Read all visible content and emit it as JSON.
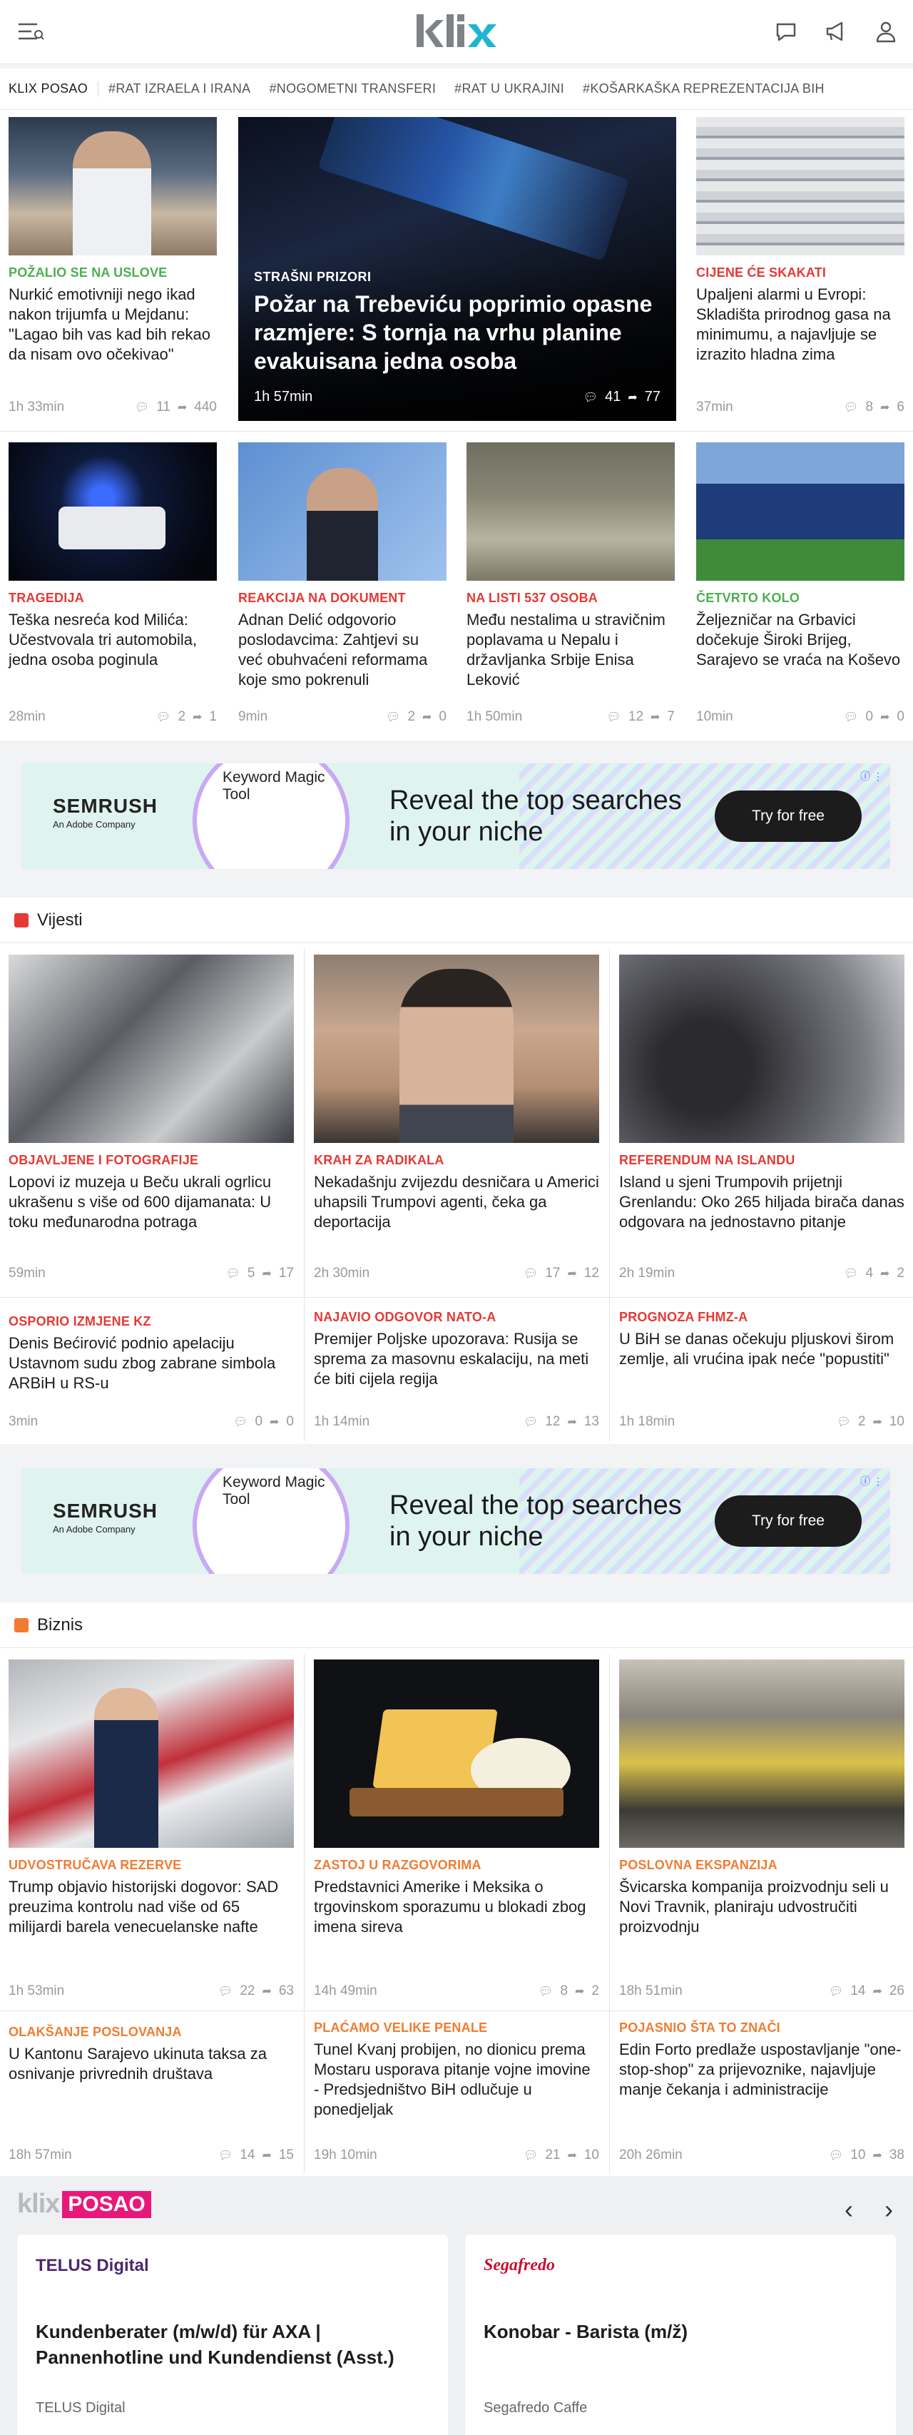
{
  "header": {
    "logo": "klix",
    "icons": [
      "menu-icon",
      "chat-icon",
      "megaphone-icon",
      "user-icon"
    ]
  },
  "tags": [
    "KLIX POSAO",
    "#RAT IZRAELA I IRANA",
    "#NOGOMETNI TRANSFERI",
    "#RAT U UKRAJINI",
    "#KOŠARKAŠKA REPREZENTACIJA BIH"
  ],
  "top": {
    "hero": {
      "category": "STRAŠNI PRIZORI",
      "title": "Požar na Trebeviću poprimio opasne razmjere: S tornja na vrhu planine evakuisana jedna osoba",
      "time": "1h 57min",
      "comments": "41",
      "shares": "77"
    },
    "cards": [
      {
        "category": "POŽALIO SE NA USLOVE",
        "color": "#4caf50",
        "title": "Nurkić emotivniji nego ikad nakon trijumfa u Mejdanu: \"Lagao bih vas kad bih rekao da nisam ovo očekivao\"",
        "time": "1h 33min",
        "comments": "11",
        "shares": "440"
      },
      {
        "category": "CIJENE ĆE SKAKATI",
        "color": "#e53935",
        "title": "Upaljeni alarmi u Evropi: Skladišta prirodnog gasa na minimumu, a najavljuje se izrazito hladna zima",
        "time": "37min",
        "comments": "8",
        "shares": "6"
      },
      {
        "category": "TRAGEDIJA",
        "color": "#e53935",
        "title": "Teška nesreća kod Milića: Učestvovala tri automobila, jedna osoba poginula",
        "time": "28min",
        "comments": "2",
        "shares": "1"
      },
      {
        "category": "REAKCIJA NA DOKUMENT",
        "color": "#e53935",
        "title": "Adnan Delić odgovorio poslodavcima: Zahtjevi su već obuhvaćeni reformama koje smo pokrenuli",
        "time": "9min",
        "comments": "2",
        "shares": "0"
      },
      {
        "category": "NA LISTI 537 OSOBA",
        "color": "#e53935",
        "title": "Među nestalima u stravičnim poplavama u Nepalu i državljanka Srbije Enisa Leković",
        "time": "1h 50min",
        "comments": "12",
        "shares": "7"
      },
      {
        "category": "ČETVRTO KOLO",
        "color": "#4caf50",
        "title": "Željezničar na Grbavici dočekuje Široki Brijeg, Sarajevo se vraća na Koševo",
        "time": "10min",
        "comments": "0",
        "shares": "0"
      }
    ]
  },
  "ad": {
    "brand": "SEMRUSH",
    "brand_sub": "An Adobe Company",
    "tool": "Keyword Magic Tool",
    "headline": "Reveal the top searches in your niche",
    "cta": "Try for free"
  },
  "vijesti": {
    "label": "Vijesti",
    "color": "#e53935",
    "cards": [
      {
        "category": "OBJAVLJENE I FOTOGRAFIJE",
        "title": "Lopovi iz muzeja u Beču ukrali ogrlicu ukrašenu s više od 600 dijamanata: U toku međunarodna potraga",
        "time": "59min",
        "comments": "5",
        "shares": "17"
      },
      {
        "category": "KRAH ZA RADIKALA",
        "title": "Nekadašnju zvijezdu desničara u Americi uhapsili Trumpovi agenti, čeka ga deportacija",
        "time": "2h 30min",
        "comments": "17",
        "shares": "12"
      },
      {
        "category": "REFERENDUM NA ISLANDU",
        "title": "Island u sjeni Trumpovih prijetnji Grenlandu: Oko 265 hiljada birača danas odgovara na jednostavno pitanje",
        "time": "2h 19min",
        "comments": "4",
        "shares": "2"
      },
      {
        "category": "OSPORIO IZMJENE KZ",
        "title": "Denis Bećirović podnio apelaciju Ustavnom sudu zbog zabrane simbola ARBiH u RS-u",
        "time": "3min",
        "comments": "0",
        "shares": "0"
      },
      {
        "category": "NAJAVIO ODGOVOR NATO-A",
        "title": "Premijer Poljske upozorava: Rusija se sprema za masovnu eskalaciju, na meti će biti cijela regija",
        "time": "1h 14min",
        "comments": "12",
        "shares": "13"
      },
      {
        "category": "PROGNOZA FHMZ-A",
        "title": "U BiH se danas očekuju pljuskovi širom zemlje, ali vrućina ipak neće \"popustiti\"",
        "time": "1h 18min",
        "comments": "2",
        "shares": "10"
      }
    ]
  },
  "biznis": {
    "label": "Biznis",
    "color": "#f07c32",
    "cards": [
      {
        "category": "UDVOSTRUČAVA REZERVE",
        "title": "Trump objavio historijski dogovor: SAD preuzima kontrolu nad više od 65 milijardi barela venecuelanske nafte",
        "time": "1h 53min",
        "comments": "22",
        "shares": "63"
      },
      {
        "category": "ZASTOJ U RAZGOVORIMA",
        "title": "Predstavnici Amerike i Meksika o trgovinskom sporazumu u blokadi zbog imena sireva",
        "time": "14h 49min",
        "comments": "8",
        "shares": "2"
      },
      {
        "category": "POSLOVNA EKSPANZIJA",
        "title": "Švicarska kompanija proizvodnju seli u Novi Travnik, planiraju udvostručiti proizvodnju",
        "time": "18h 51min",
        "comments": "14",
        "shares": "26"
      },
      {
        "category": "OLAKŠANJE POSLOVANJA",
        "title": "U Kantonu Sarajevo ukinuta taksa za osnivanje privrednih društava",
        "time": "18h 57min",
        "comments": "14",
        "shares": "15"
      },
      {
        "category": "PLAĆAMO VELIKE PENALE",
        "title": "Tunel Kvanj probijen, no dionicu prema Mostaru usporava pitanje vojne imovine - Predsjedništvo BiH odlučuje u ponedjeljak",
        "time": "19h 10min",
        "comments": "21",
        "shares": "10"
      },
      {
        "category": "POJASNIO ŠTA TO ZNAČI",
        "title": "Edin Forto predlaže uspostavljanje \"one-stop-shop\" za prijevoznike, najavljuje manje čekanja i administracije",
        "time": "20h 26min",
        "comments": "10",
        "shares": "38"
      }
    ]
  },
  "posao": {
    "logo": "klix",
    "badge": "POSAO",
    "jobs": [
      {
        "company_logo": "TELUS Digital",
        "title": "Kundenberater (m/w/d) für AXA | Pannenhotline und Kundendienst (Asst.)",
        "company": "TELUS Digital"
      },
      {
        "company_logo": "Segafredo",
        "title": "Konobar - Barista (m/ž)",
        "company": "Segafredo Caffe"
      }
    ]
  }
}
